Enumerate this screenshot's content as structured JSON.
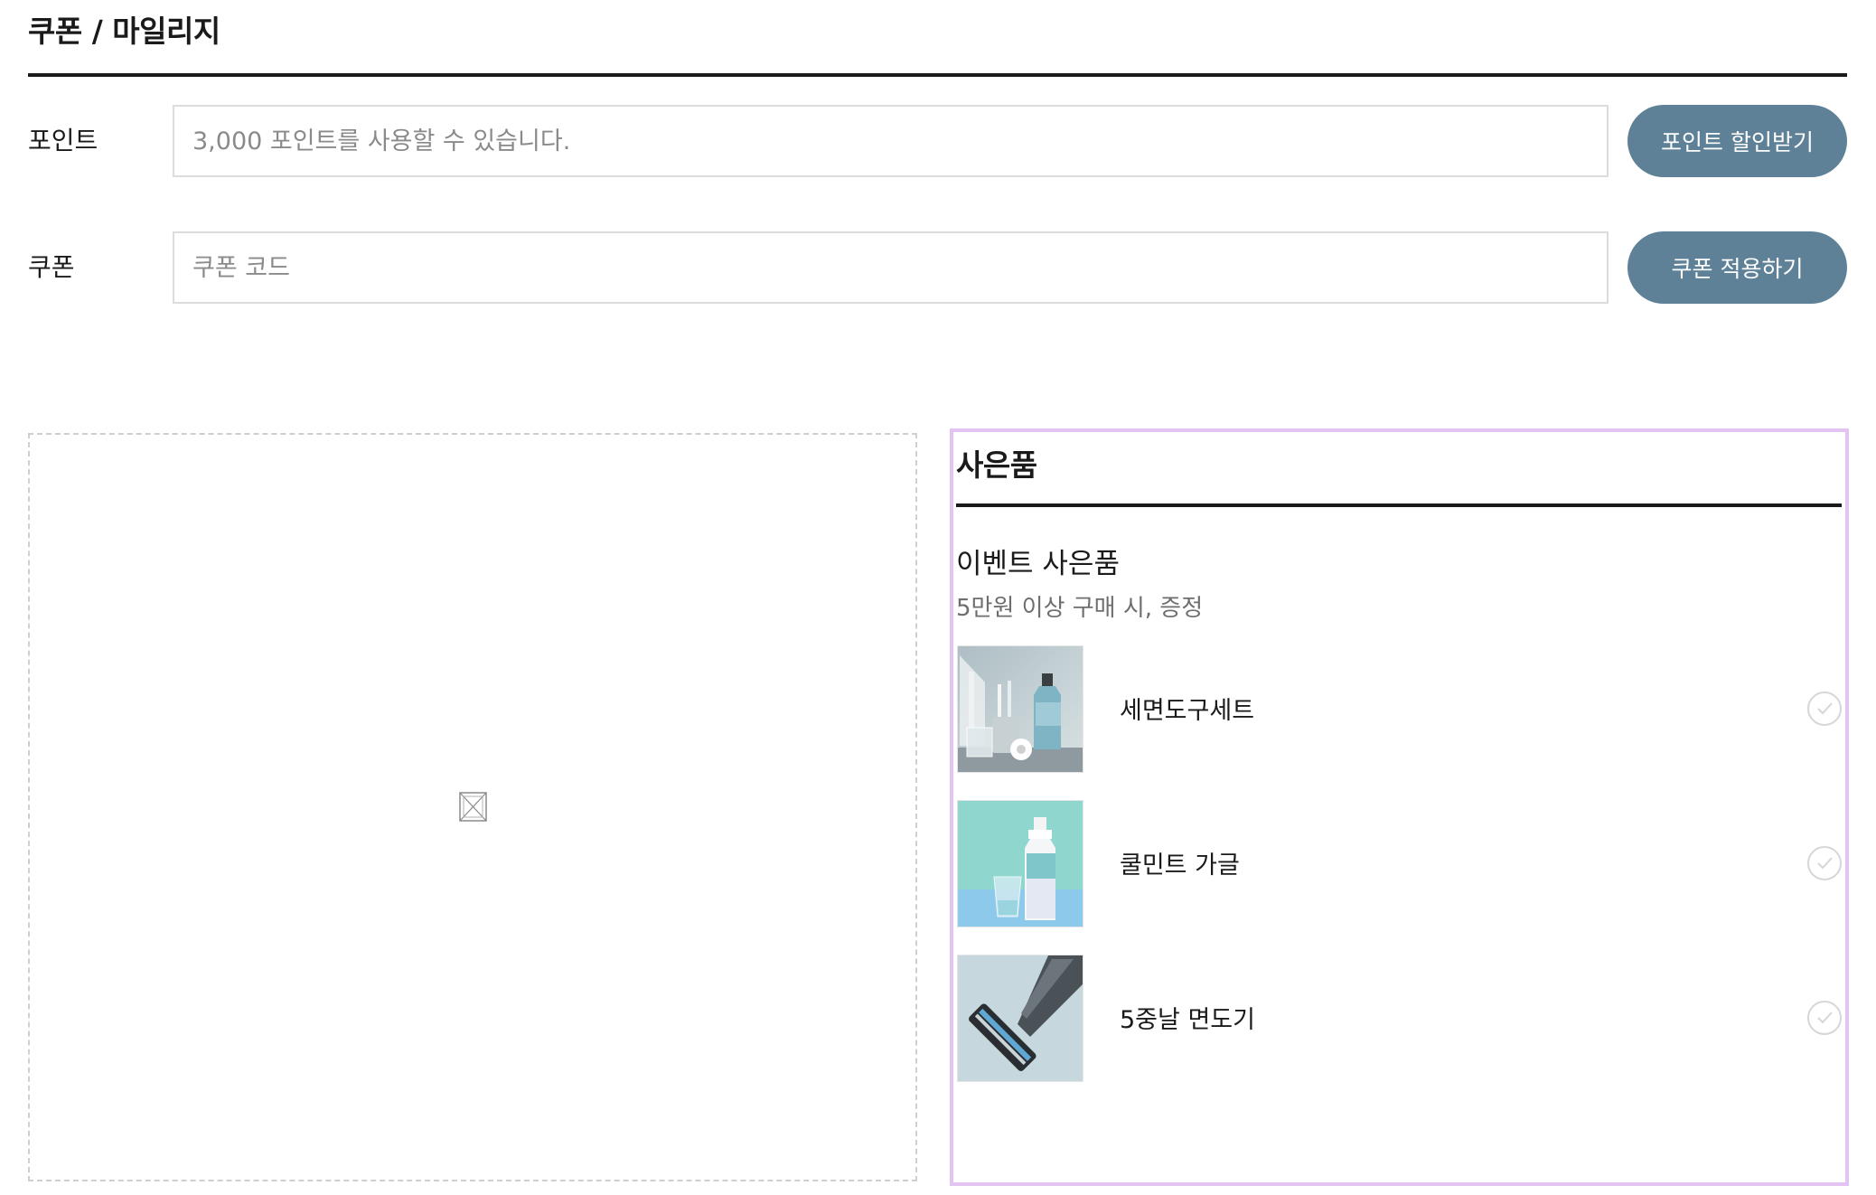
{
  "coupon_section": {
    "title": "쿠폰 / 마일리지",
    "points": {
      "label": "포인트",
      "placeholder": "3,000 포인트를 사용할 수 있습니다.",
      "button_label": "포인트 할인받기"
    },
    "coupon": {
      "label": "쿠폰",
      "placeholder": "쿠폰 코드",
      "button_label": "쿠폰 적용하기"
    }
  },
  "image_box": {
    "icon": "broken-image-icon"
  },
  "gift_section": {
    "title": "사은품",
    "event_name": "이벤트 사은품",
    "event_description": "5만원 이상 구매 시, 증정",
    "items": [
      {
        "name": "세면도구세트",
        "thumbnail": "toiletries-thumbnail",
        "selected": false
      },
      {
        "name": "쿨민트 가글",
        "thumbnail": "mouthwash-thumbnail",
        "selected": false
      },
      {
        "name": "5중날 면도기",
        "thumbnail": "razor-thumbnail",
        "selected": false
      }
    ]
  },
  "colors": {
    "button_bg": "#5e8198",
    "button_text": "#ffffff",
    "rule": "#1a1a1a",
    "panel_highlight": "#e2c3f1",
    "input_border": "#dcdcdc",
    "muted_text": "#6e6e6e"
  }
}
